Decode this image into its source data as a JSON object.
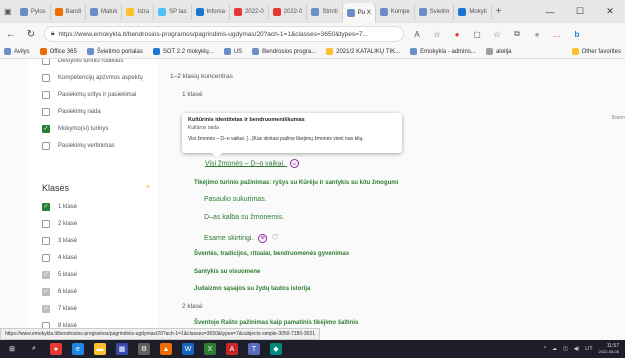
{
  "browser": {
    "tabs": [
      {
        "label": "Pylos",
        "color": "#6a8fc7"
      },
      {
        "label": "Bandi",
        "color": "#ef6c00"
      },
      {
        "label": "Matuk",
        "color": "#6a8fc7"
      },
      {
        "label": "Istra",
        "color": "#fbc02d"
      },
      {
        "label": "SP tas",
        "color": "#4fc3f7"
      },
      {
        "label": "Infoma",
        "color": "#1976d2"
      },
      {
        "label": "2022-0",
        "color": "#e53935"
      },
      {
        "label": "2022-0",
        "color": "#e53935"
      },
      {
        "label": "Strinti",
        "color": "#6a8fc7"
      },
      {
        "label": "Pu X",
        "color": "#6a8fc7",
        "active": true
      },
      {
        "label": "Kompe",
        "color": "#6a8fc7"
      },
      {
        "label": "Svietim",
        "color": "#6a8fc7"
      },
      {
        "label": "Mokyti",
        "color": "#1976d2"
      }
    ],
    "new_tab": "+",
    "minimize": "—",
    "maximize": "☐",
    "close": "✕",
    "url": "https://www.emokykla.lt/bendrosios-programos/pagrindinis-ugdymas/20?ach-1=1&classes=3650&types=7...",
    "read_aloud": "A",
    "bookmarks": [
      {
        "label": "Avilys",
        "color": "#6a8fc7"
      },
      {
        "label": "Office 365",
        "color": "#ef6c00"
      },
      {
        "label": "Švietimo portalas",
        "color": "#6a8fc7"
      },
      {
        "label": "SOT 2.2 mokyklų...",
        "color": "#1976d2"
      },
      {
        "label": "US",
        "color": "#6a8fc7"
      },
      {
        "label": "Bendrosios progra...",
        "color": "#6a8fc7"
      },
      {
        "label": "2021/2 KATALIKŲ TIK...",
        "color": "#fbc02d"
      },
      {
        "label": "Emokykla - admins...",
        "color": "#6a8fc7"
      },
      {
        "label": "ateilja",
        "color": "#9e9e9e"
      }
    ],
    "other_favorites": "Other favorites",
    "status_url": "https://www.emokykla.lt/bendrosios-programos/pagrindinis-ugdymas/20?ach-1=1&classes=3650&types=7&subjects-simple-3050-7180-3021"
  },
  "sidebar": {
    "filters": [
      {
        "label": "Dėstymo turinio rodiklius",
        "state": "off"
      },
      {
        "label": "Kompetencijų apżvmos aspektų",
        "state": "off"
      },
      {
        "label": "Pasiekimų sritys ir pasiekimai",
        "state": "off"
      },
      {
        "label": "Pasiekimų raida",
        "state": "off"
      },
      {
        "label": "Mokymo(si) turinys",
        "state": "on"
      },
      {
        "label": "Pasiekimų vertinimas",
        "state": "off"
      }
    ],
    "section_title": "Klasės",
    "section_chev": "^",
    "classes": [
      {
        "label": "1 klasė",
        "state": "on"
      },
      {
        "label": "2 klasė",
        "state": "off"
      },
      {
        "label": "3 klasė",
        "state": "off"
      },
      {
        "label": "4 klasė",
        "state": "off"
      },
      {
        "label": "5 klasė",
        "state": "grey"
      },
      {
        "label": "6 klasė",
        "state": "grey"
      },
      {
        "label": "7 klasė",
        "state": "grey"
      },
      {
        "label": "8 klasė",
        "state": "off"
      }
    ]
  },
  "main": {
    "concentration": "1–2 klasių koncentras",
    "class1": "1 klasė",
    "tooltip": {
      "title": "Kultūrinis identitetas ir bendruomeniškumas",
      "subtitle": "Kultūros raida",
      "body": "Visi žmonės – D–o vaikai. [...]Kas skiriasi pažinę likejimų žmonės vieni nuo kitų."
    },
    "item_link": "Visi žmonės – D–o vaikai.",
    "heading_main": "Tikėjimo turinio pažinimas: ryšys su Kūrėju ir santykis su kitu žmogumi",
    "sub1": "Pasaulio sukurimas.",
    "sub2": "D–as kalba su žmonemis.",
    "sub3": "Esame skirtingi.",
    "heading2": "Šventės, tradicijos, ritualai, bendruomenės gyvenimas",
    "heading3": "Santykis su visuomene",
    "heading4": "Judaizmo sąsajos su žydų tautos istorija",
    "class2": "2 klasė",
    "heading5": "Šventojo Rašto pažinimas kaip pamatinis tikėjimo šaltinis",
    "right_edge": "Baren"
  },
  "taskbar": {
    "icons": [
      {
        "name": "windows-start-icon",
        "glyph": "⊞",
        "color": "#1e1e2a"
      },
      {
        "name": "search-icon",
        "glyph": "⌕",
        "color": "#1e1e2a"
      },
      {
        "name": "chrome-icon",
        "glyph": "●",
        "color": "#e53935"
      },
      {
        "name": "edge-icon",
        "glyph": "e",
        "color": "#1e88e5"
      },
      {
        "name": "explorer-icon",
        "glyph": "▬",
        "color": "#fbc02d"
      },
      {
        "name": "store-icon",
        "glyph": "▦",
        "color": "#3949ab"
      },
      {
        "name": "settings-icon",
        "glyph": "⚙",
        "color": "#616161"
      },
      {
        "name": "brave-icon",
        "glyph": "▲",
        "color": "#ef6c00"
      },
      {
        "name": "word-icon",
        "glyph": "W",
        "color": "#1565c0"
      },
      {
        "name": "excel-icon",
        "glyph": "X",
        "color": "#2e7d32"
      },
      {
        "name": "acrobat-icon",
        "glyph": "A",
        "color": "#c62828"
      },
      {
        "name": "teams-icon",
        "glyph": "T",
        "color": "#5c6bc0"
      },
      {
        "name": "vpn-icon",
        "glyph": "◆",
        "color": "#00897b"
      }
    ],
    "lang": "LIT",
    "time": "11:57",
    "date": "2022-05-08"
  }
}
